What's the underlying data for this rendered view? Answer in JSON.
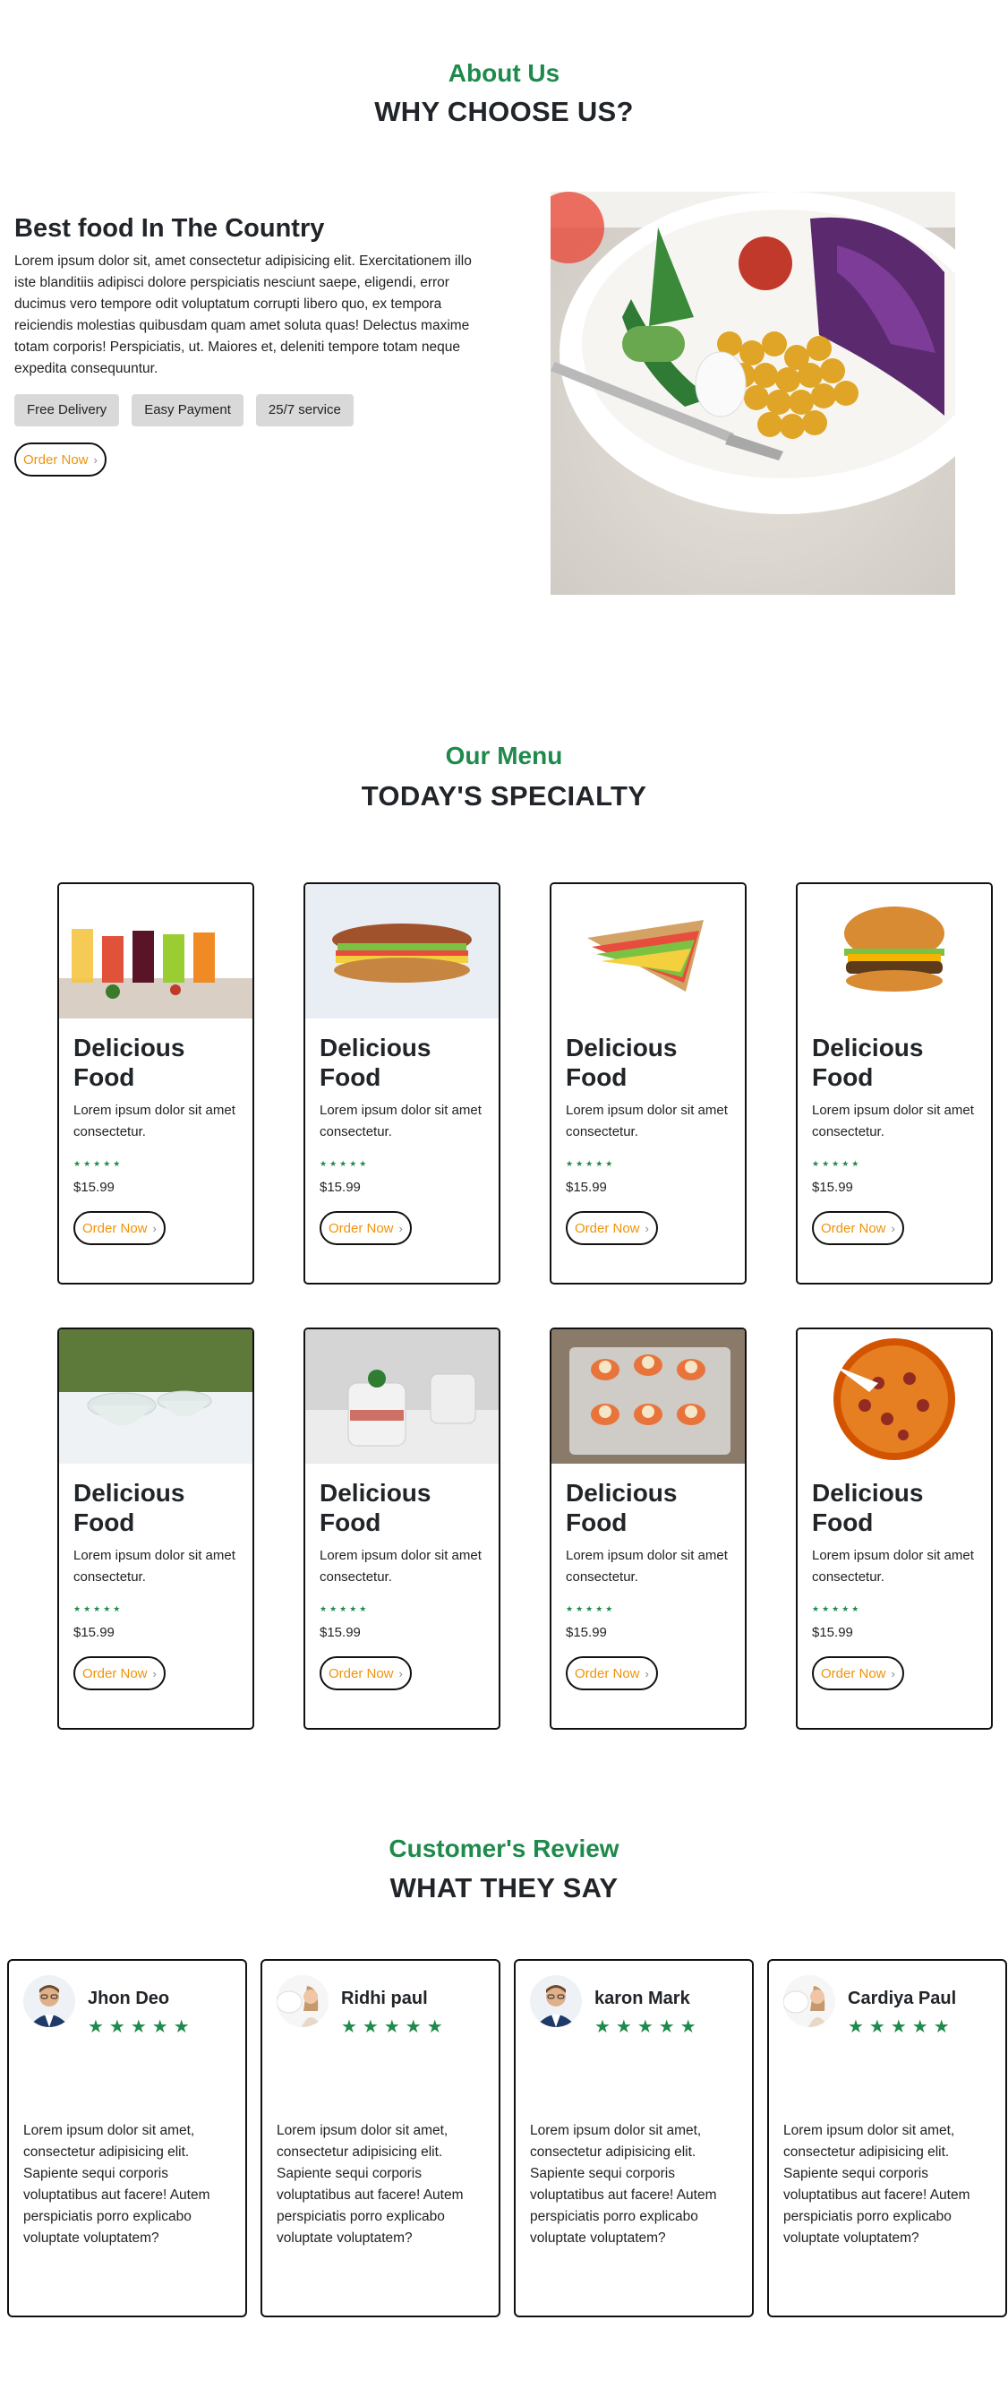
{
  "about": {
    "subtitle": "About Us",
    "title": "WHY CHOOSE US?",
    "heading": "Best food In The Country",
    "paragraph": "Lorem ipsum dolor sit, amet consectetur adipisicing elit. Exercitationem illo iste blanditiis adipisci dolore perspiciatis nesciunt saepe, eligendi, error ducimus vero tempore odit voluptatum corrupti libero quo, ex tempora reiciendis molestias quibusdam quam amet soluta quas! Delectus maxime totam corporis! Perspiciatis, ut. Maiores et, deleniti tempore totam neque expedita consequuntur.",
    "tags": [
      "Free Delivery",
      "Easy Payment",
      "25/7 service"
    ],
    "order_label": "Order Now",
    "image_icon": "salad-bowl-image"
  },
  "menu": {
    "subtitle": "Our Menu",
    "title": "TODAY'S SPECIALTY",
    "items": [
      {
        "title": "Delicious Food",
        "desc": "Lorem ipsum dolor sit amet consectetur.",
        "stars": "★★★★★",
        "price": "$15.99",
        "order_label": "Order Now",
        "image": "juices-image"
      },
      {
        "title": "Delicious Food",
        "desc": "Lorem ipsum dolor sit amet consectetur.",
        "stars": "★★★★★",
        "price": "$15.99",
        "order_label": "Order Now",
        "image": "sandwich-image"
      },
      {
        "title": "Delicious Food",
        "desc": "Lorem ipsum dolor sit amet consectetur.",
        "stars": "★★★★★",
        "price": "$15.99",
        "order_label": "Order Now",
        "image": "club-sandwich-image"
      },
      {
        "title": "Delicious Food",
        "desc": "Lorem ipsum dolor sit amet consectetur.",
        "stars": "★★★★★",
        "price": "$15.99",
        "order_label": "Order Now",
        "image": "burger-image"
      },
      {
        "title": "Delicious Food",
        "desc": "Lorem ipsum dolor sit amet consectetur.",
        "stars": "★★★★★",
        "price": "$15.99",
        "order_label": "Order Now",
        "image": "dessert-bowls-image"
      },
      {
        "title": "Delicious Food",
        "desc": "Lorem ipsum dolor sit amet consectetur.",
        "stars": "★★★★★",
        "price": "$15.99",
        "order_label": "Order Now",
        "image": "parfait-image"
      },
      {
        "title": "Delicious Food",
        "desc": "Lorem ipsum dolor sit amet consectetur.",
        "stars": "★★★★★",
        "price": "$15.99",
        "order_label": "Order Now",
        "image": "stuffed-peppers-image"
      },
      {
        "title": "Delicious Food",
        "desc": "Lorem ipsum dolor sit amet consectetur.",
        "stars": "★★★★★",
        "price": "$15.99",
        "order_label": "Order Now",
        "image": "pizza-image"
      }
    ]
  },
  "reviews": {
    "subtitle": "Customer's Review",
    "title": "WHAT THEY SAY",
    "items": [
      {
        "name": "Jhon Deo",
        "stars": "★★★★★",
        "text": "Lorem ipsum dolor sit amet, consectetur adipisicing elit. Sapiente sequi corporis voluptatibus aut facere! Autem perspiciatis porro explicabo voluptate voluptatem?",
        "avatar": "man-avatar"
      },
      {
        "name": "Ridhi paul",
        "stars": "★★★★★",
        "text": "Lorem ipsum dolor sit amet, consectetur adipisicing elit. Sapiente sequi corporis voluptatibus aut facere! Autem perspiciatis porro explicabo voluptate voluptatem?",
        "avatar": "woman-avatar"
      },
      {
        "name": "karon Mark",
        "stars": "★★★★★",
        "text": "Lorem ipsum dolor sit amet, consectetur adipisicing elit. Sapiente sequi corporis voluptatibus aut facere! Autem perspiciatis porro explicabo voluptate voluptatem?",
        "avatar": "man-avatar"
      },
      {
        "name": "Cardiya Paul",
        "stars": "★★★★★",
        "text": "Lorem ipsum dolor sit amet, consectetur adipisicing elit. Sapiente sequi corporis voluptatibus aut facere! Autem perspiciatis porro explicabo voluptate voluptatem?",
        "avatar": "woman-avatar"
      }
    ]
  },
  "colors": {
    "accent_green": "#1e8a4c",
    "order_orange": "#f0930a",
    "text_dark": "#212529"
  }
}
